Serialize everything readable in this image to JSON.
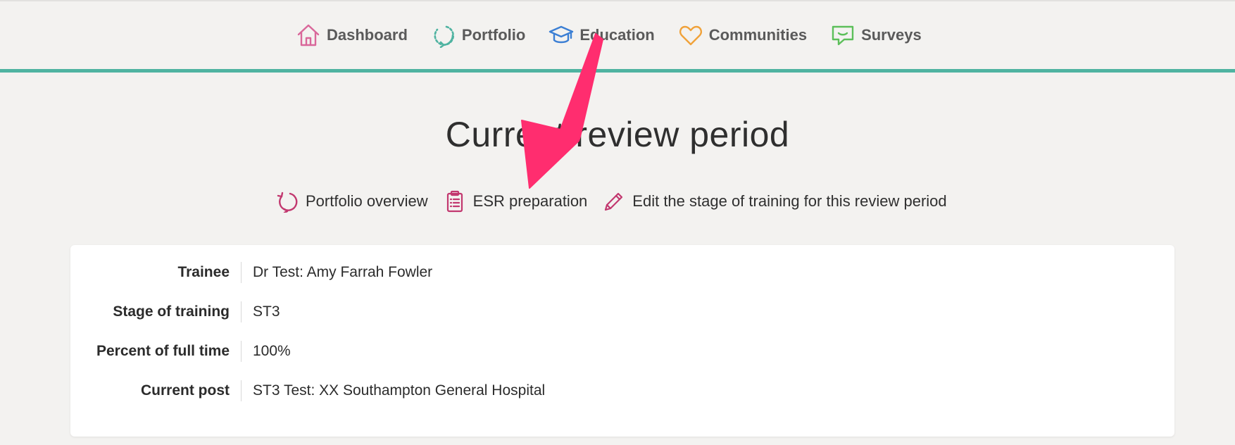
{
  "nav": {
    "items": [
      {
        "label": "Dashboard",
        "icon": "house-icon"
      },
      {
        "label": "Portfolio",
        "icon": "circular-arrow-icon"
      },
      {
        "label": "Education",
        "icon": "graduation-cap-icon"
      },
      {
        "label": "Communities",
        "icon": "heart-icon"
      },
      {
        "label": "Surveys",
        "icon": "speech-bubble-icon"
      }
    ],
    "accent_color": "#4fb3a1"
  },
  "title": "Current review period",
  "actions": [
    {
      "label": "Portfolio overview",
      "icon": "circular-arrow-icon"
    },
    {
      "label": "ESR preparation",
      "icon": "clipboard-icon"
    },
    {
      "label": "Edit the stage of training for this review period",
      "icon": "pencil-icon"
    }
  ],
  "info": {
    "trainee_label": "Trainee",
    "trainee_value": "Dr Test: Amy Farrah Fowler",
    "stage_label": "Stage of training",
    "stage_value": "ST3",
    "percent_label": "Percent of full time",
    "percent_value": "100%",
    "post_label": "Current post",
    "post_value": "ST3 Test: XX Southampton General Hospital"
  },
  "colors": {
    "dashboard_icon": "#d9679a",
    "portfolio_icon": "#4fb3a1",
    "education_icon": "#3b7fd4",
    "communities_icon": "#f0a23a",
    "surveys_icon": "#5cbf5a",
    "action_icon": "#c2386f",
    "annotation_arrow": "#ff2d6f"
  }
}
